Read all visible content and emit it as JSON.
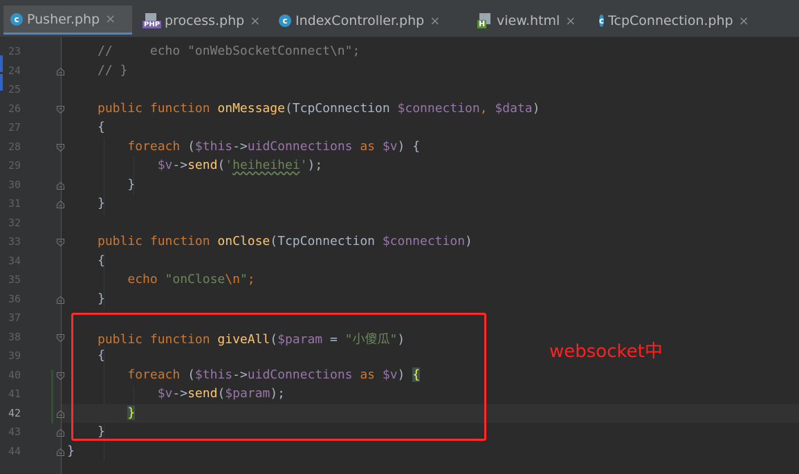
{
  "tabs": [
    {
      "label": "Pusher.php",
      "icon": "c",
      "active": true
    },
    {
      "label": "process.php",
      "icon": "php",
      "active": false
    },
    {
      "label": "IndexController.php",
      "icon": "c",
      "active": false
    },
    {
      "label": "view.html",
      "icon": "html",
      "active": false
    },
    {
      "label": "TcpConnection.php",
      "icon": "c",
      "active": false
    }
  ],
  "close_glyph": "×",
  "annotation": "websocket中",
  "current_line": "42",
  "lines": [
    {
      "n": "23",
      "tokens": [
        [
          "cm",
          "//     echo \"onWebSocketConnect\\n\";"
        ]
      ]
    },
    {
      "n": "24",
      "tokens": [
        [
          "cm",
          "// }"
        ]
      ]
    },
    {
      "n": "25",
      "tokens": []
    },
    {
      "n": "26",
      "tokens": [
        [
          "kw",
          "public "
        ],
        [
          "kw",
          "function "
        ],
        [
          "fn",
          "onMessage"
        ],
        [
          "punc",
          "("
        ],
        [
          "cls",
          "TcpConnection "
        ],
        [
          "var",
          "$connection"
        ],
        [
          "kw",
          ", "
        ],
        [
          "var",
          "$data"
        ],
        [
          "punc",
          ")"
        ]
      ]
    },
    {
      "n": "27",
      "tokens": [
        [
          "punc",
          "{"
        ]
      ]
    },
    {
      "n": "28",
      "tokens": [
        [
          "sp",
          "    "
        ],
        [
          "kw",
          "foreach "
        ],
        [
          "punc",
          "("
        ],
        [
          "var",
          "$this"
        ],
        [
          "punc",
          "->"
        ],
        [
          "var",
          "uidConnections "
        ],
        [
          "kw",
          "as "
        ],
        [
          "var",
          "$v"
        ],
        [
          "punc",
          ") {"
        ]
      ]
    },
    {
      "n": "29",
      "tokens": [
        [
          "sp",
          "        "
        ],
        [
          "var",
          "$v"
        ],
        [
          "punc",
          "->"
        ],
        [
          "fn",
          "send"
        ],
        [
          "punc",
          "("
        ],
        [
          "str",
          "'"
        ],
        [
          "strw",
          "heiheihei"
        ],
        [
          "str",
          "'"
        ],
        [
          "punc",
          ");"
        ]
      ]
    },
    {
      "n": "30",
      "tokens": [
        [
          "sp",
          "    "
        ],
        [
          "punc",
          "}"
        ]
      ]
    },
    {
      "n": "31",
      "tokens": [
        [
          "punc",
          "}"
        ]
      ]
    },
    {
      "n": "32",
      "tokens": []
    },
    {
      "n": "33",
      "tokens": [
        [
          "kw",
          "public "
        ],
        [
          "kw",
          "function "
        ],
        [
          "fn",
          "onClose"
        ],
        [
          "punc",
          "("
        ],
        [
          "cls",
          "TcpConnection "
        ],
        [
          "var",
          "$connection"
        ],
        [
          "punc",
          ")"
        ]
      ]
    },
    {
      "n": "34",
      "tokens": [
        [
          "punc",
          "{"
        ]
      ]
    },
    {
      "n": "35",
      "tokens": [
        [
          "sp",
          "    "
        ],
        [
          "kw",
          "echo "
        ],
        [
          "str",
          "\"onClose"
        ],
        [
          "esc",
          "\\n"
        ],
        [
          "str",
          "\""
        ],
        [
          "kw",
          ";"
        ]
      ]
    },
    {
      "n": "36",
      "tokens": [
        [
          "punc",
          "}"
        ]
      ]
    },
    {
      "n": "37",
      "tokens": []
    },
    {
      "n": "38",
      "tokens": [
        [
          "kw",
          "public "
        ],
        [
          "kw",
          "function "
        ],
        [
          "fn",
          "giveAll"
        ],
        [
          "punc",
          "("
        ],
        [
          "var",
          "$param "
        ],
        [
          "op",
          "= "
        ],
        [
          "str",
          "\"小傻瓜\""
        ],
        [
          "punc",
          ")"
        ]
      ]
    },
    {
      "n": "39",
      "tokens": [
        [
          "punc",
          "{"
        ]
      ]
    },
    {
      "n": "40",
      "tokens": [
        [
          "sp",
          "    "
        ],
        [
          "kw",
          "foreach "
        ],
        [
          "punc",
          "("
        ],
        [
          "var",
          "$this"
        ],
        [
          "punc",
          "->"
        ],
        [
          "var",
          "uidConnections "
        ],
        [
          "kw",
          "as "
        ],
        [
          "var",
          "$v"
        ],
        [
          "punc",
          ") "
        ],
        [
          "hl",
          "{"
        ]
      ]
    },
    {
      "n": "41",
      "tokens": [
        [
          "sp",
          "        "
        ],
        [
          "var",
          "$v"
        ],
        [
          "punc",
          "->"
        ],
        [
          "fn",
          "send"
        ],
        [
          "punc",
          "("
        ],
        [
          "var",
          "$param"
        ],
        [
          "punc",
          ");"
        ]
      ]
    },
    {
      "n": "42",
      "tokens": [
        [
          "sp",
          "    "
        ],
        [
          "hl",
          "}"
        ]
      ]
    },
    {
      "n": "43",
      "tokens": [
        [
          "punc",
          "}"
        ]
      ]
    },
    {
      "n": "44",
      "tokens": [
        [
          "punc",
          "}"
        ]
      ]
    }
  ]
}
